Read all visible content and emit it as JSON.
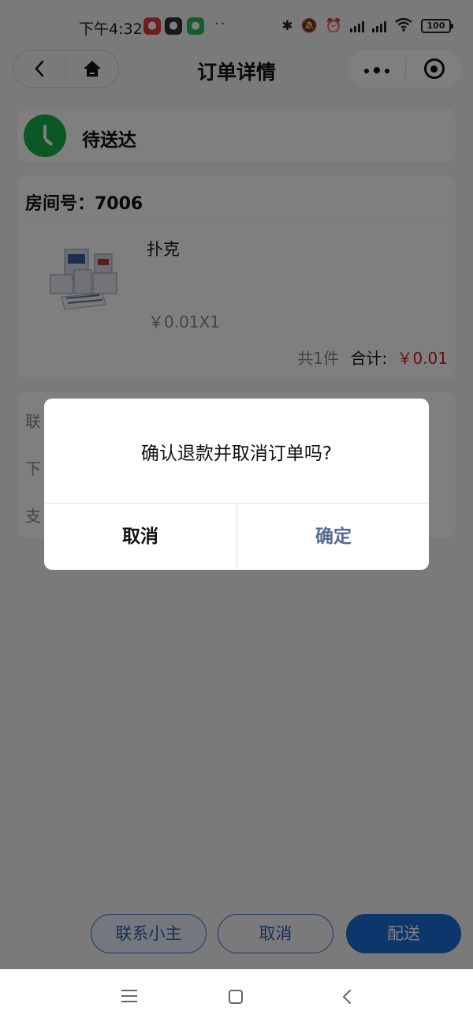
{
  "status_bar": {
    "time": "下午4:32",
    "battery": "100",
    "dots": "··"
  },
  "nav": {
    "title": "订单详情",
    "back_icon": "chevron-left-icon",
    "home_icon": "home-icon",
    "more_icon": "more-dots-icon",
    "target_icon": "target-icon"
  },
  "order": {
    "status": "待送达",
    "room_label": "房间号：7006",
    "product_name": "扑克",
    "product_price": "￥0.01X1",
    "item_count": "共1件",
    "total_label": "合计:",
    "total_amount": "￥0.01"
  },
  "info_rows": [
    "联",
    "下",
    "支"
  ],
  "actions": {
    "contact": "联系小主",
    "cancel": "取消",
    "deliver": "配送"
  },
  "dialog": {
    "message": "确认退款并取消订单吗?",
    "cancel": "取消",
    "confirm": "确定"
  },
  "colors": {
    "accent_blue": "#1a6fd8",
    "status_green": "#18b14a",
    "price_red": "#d21b1b",
    "dialog_confirm": "#576b95"
  }
}
